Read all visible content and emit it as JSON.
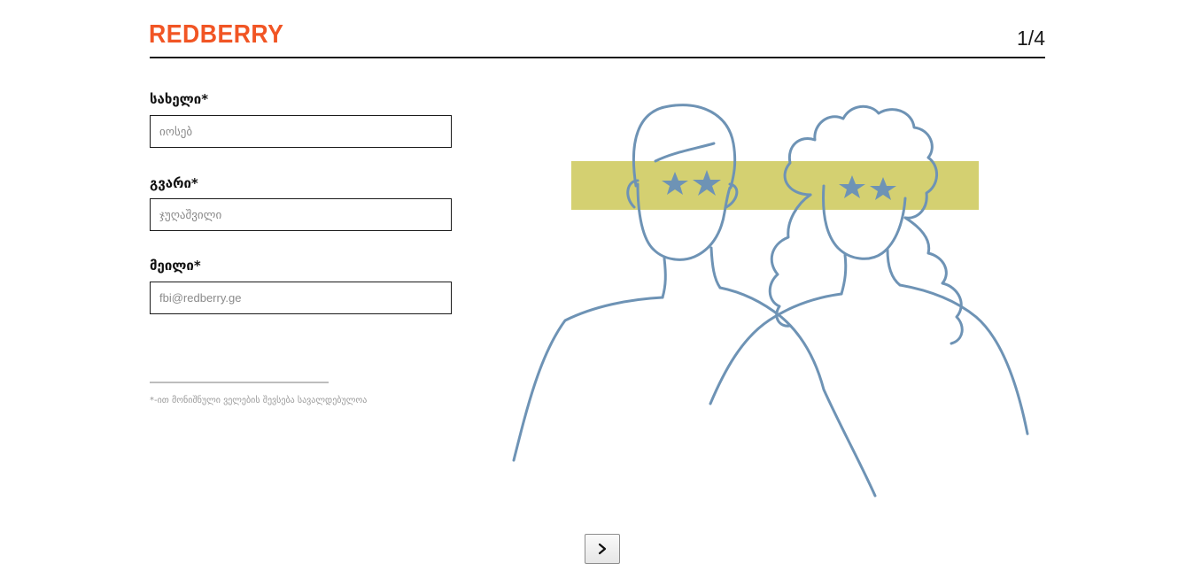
{
  "header": {
    "logo_text": "REDBERRY",
    "page_indicator": "1/4"
  },
  "form": {
    "first_name": {
      "label": "სახელი*",
      "placeholder": "იოსებ",
      "value": ""
    },
    "last_name": {
      "label": "გვარი*",
      "placeholder": "ჯუღაშვილი",
      "value": ""
    },
    "email": {
      "label": "მეილი*",
      "placeholder": "fbi@redberry.ge",
      "value": ""
    },
    "required_note": "*-ით მონიშნული ველების შევსება სავალდებულოა"
  },
  "illustration": {
    "icon": "two-people-star-eyes-illustration",
    "colors": {
      "stroke": "#6E93B5",
      "band": "#CFCB62"
    }
  },
  "navigation": {
    "next_icon": "chevron-right-icon"
  },
  "colors": {
    "brand": "#F15524",
    "text": "#111111",
    "border": "#1A1A1A",
    "muted": "#9A9A9A"
  }
}
